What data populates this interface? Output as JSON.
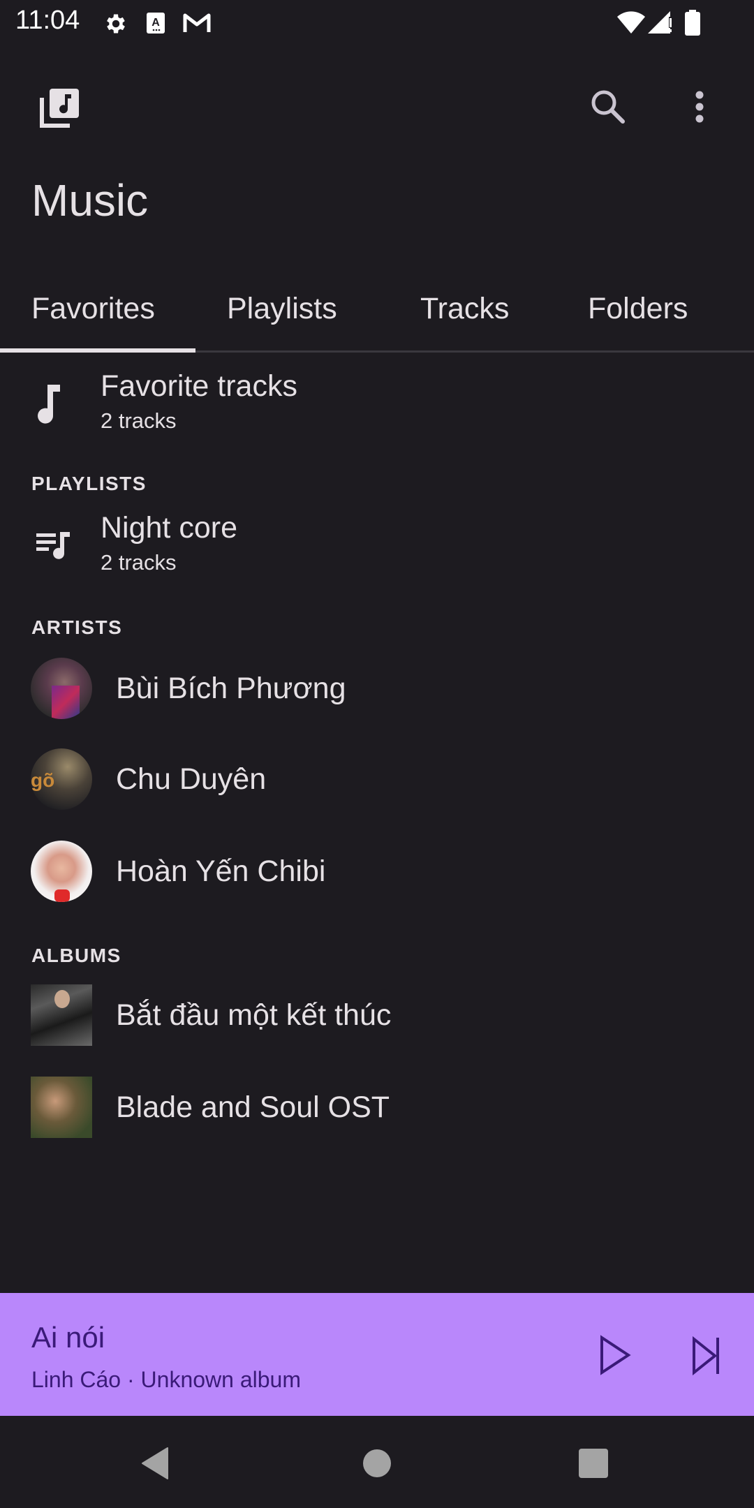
{
  "status_bar": {
    "time": "11:04",
    "left_icons": [
      "settings-gear-icon",
      "keyboard-a-icon",
      "gmail-icon"
    ],
    "right_icons": [
      "wifi-icon",
      "cell-signal-alert-icon",
      "battery-full-icon"
    ]
  },
  "app_bar": {
    "logo_icon": "music-library-icon",
    "actions": [
      "search-icon",
      "more-vert-icon"
    ],
    "title": "Music"
  },
  "tabs": [
    {
      "label": "Favorites",
      "selected": true
    },
    {
      "label": "Playlists",
      "selected": false
    },
    {
      "label": "Tracks",
      "selected": false
    },
    {
      "label": "Folders",
      "selected": false
    }
  ],
  "favorites": {
    "title": "Favorite tracks",
    "subtitle": "2 tracks",
    "icon": "music-note-icon"
  },
  "sections": {
    "playlists": "PLAYLISTS",
    "artists": "ARTISTS",
    "albums": "ALBUMS"
  },
  "playlists": [
    {
      "title": "Night core",
      "subtitle": "2 tracks",
      "icon": "queue-music-icon"
    }
  ],
  "artists": [
    {
      "name": "Bùi Bích Phương"
    },
    {
      "name": "Chu Duyên"
    },
    {
      "name": "Hoàn Yến Chibi"
    }
  ],
  "albums": [
    {
      "name": "Bắt đầu một kết thúc"
    },
    {
      "name": "Blade and Soul OST"
    }
  ],
  "now_playing": {
    "title": "Ai nói",
    "subtitle": "Linh Cáo · Unknown album",
    "background": "#b987fb",
    "foreground": "#3a1a78"
  },
  "nav_bar": [
    "back-icon",
    "home-icon",
    "recents-icon"
  ]
}
